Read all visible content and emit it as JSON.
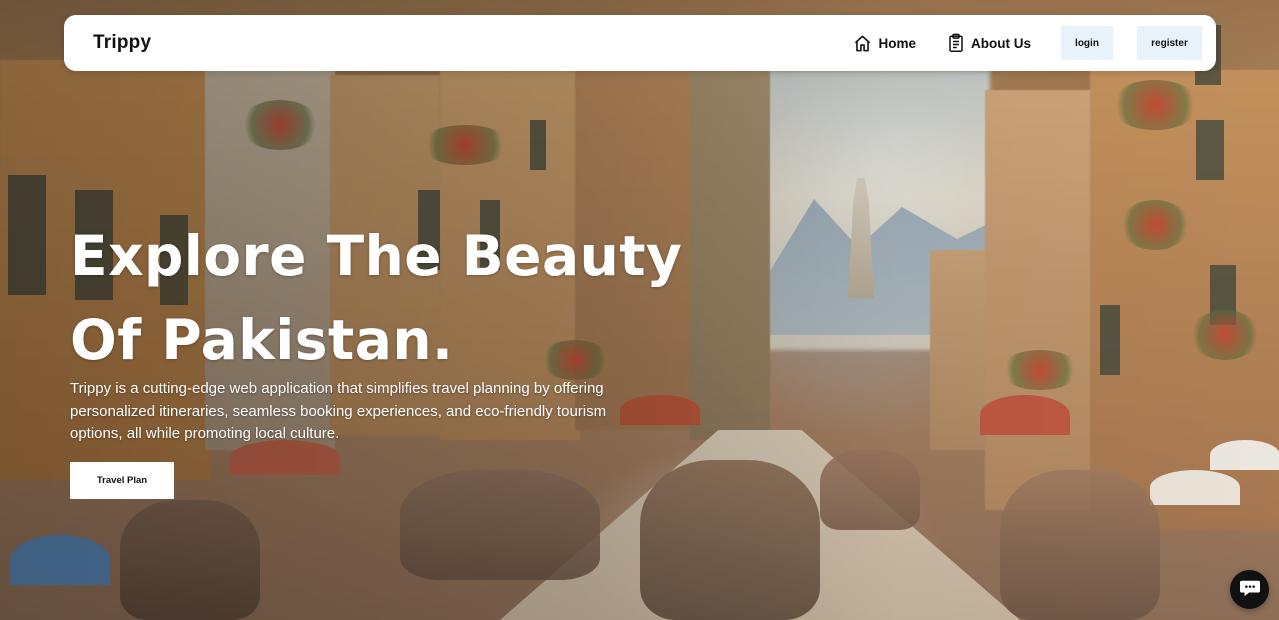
{
  "navbar": {
    "brand": "Trippy",
    "links": [
      {
        "label": "Home",
        "icon": "home-icon"
      },
      {
        "label": "About Us",
        "icon": "clipboard-icon"
      }
    ],
    "login_label": "login",
    "register_label": "register",
    "register_bg": "#e8f2fb"
  },
  "hero": {
    "title_line1": "Explore The Beauty",
    "title_line2": "Of Pakistan.",
    "description": "Trippy is a cutting-edge web application that simplifies travel planning by offering personalized itineraries, seamless booking experiences, and eco-friendly tourism options, all while promoting local culture.",
    "cta_label": "Travel Plan"
  },
  "chat": {
    "icon": "chat-bubble-icon"
  },
  "colors": {
    "navbar_bg": "#ffffff",
    "button_light": "#e8f2fb",
    "text_dark": "#111111",
    "hero_text": "#ffffff"
  }
}
